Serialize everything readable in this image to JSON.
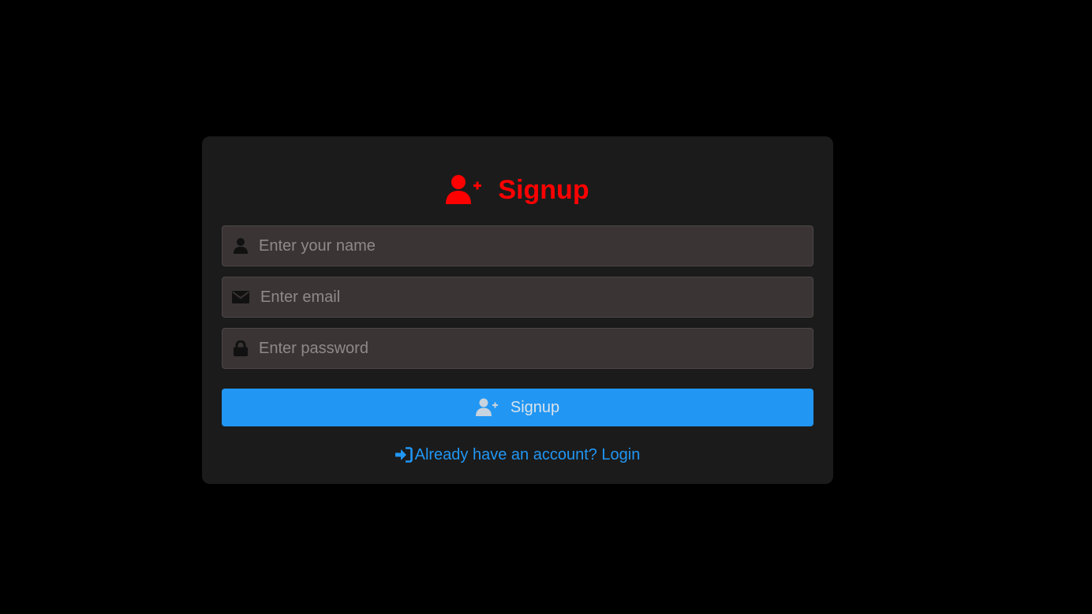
{
  "header": {
    "title": "Signup",
    "icon": "user-plus-icon",
    "title_color": "#ff0000"
  },
  "form": {
    "name": {
      "placeholder": "Enter your name",
      "value": "",
      "icon": "user-icon"
    },
    "email": {
      "placeholder": "Enter email",
      "value": "",
      "icon": "envelope-icon"
    },
    "password": {
      "placeholder": "Enter password",
      "value": "",
      "icon": "lock-icon"
    },
    "submit": {
      "label": "Signup",
      "icon": "user-plus-icon",
      "color": "#2196f3"
    }
  },
  "footer": {
    "login_text": "Already have an account? Login",
    "icon": "sign-in-icon",
    "link_color": "#2196f3"
  }
}
